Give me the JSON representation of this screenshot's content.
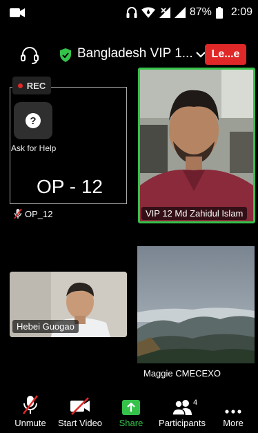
{
  "status_bar": {
    "battery_percent": "87%",
    "time": "2:09",
    "icons": [
      "video-recording-icon",
      "headphones-icon",
      "wifi-icon",
      "no-signal-icon",
      "signal-icon",
      "battery-icon"
    ]
  },
  "header": {
    "meeting_title": "Bangladesh VIP 1...",
    "leave_label": "Le...e",
    "accent_leave": "#e02828",
    "accent_secure": "#35c24a"
  },
  "tiles": {
    "op12": {
      "rec_label": "REC",
      "help_label": "Ask for Help",
      "display_name": "OP - 12",
      "label": "OP_12",
      "muted": true
    },
    "active_speaker": {
      "label": "VIP 12 Md Zahidul Islam",
      "border_color": "#35c24a"
    },
    "hebei": {
      "label": "Hebei  Guogao"
    },
    "maggie": {
      "label": "Maggie CMECEXO"
    }
  },
  "toolbar": {
    "unmute_label": "Unmute",
    "start_video_label": "Start Video",
    "share_label": "Share",
    "participants_label": "Participants",
    "participants_count": "4",
    "more_label": "More"
  }
}
